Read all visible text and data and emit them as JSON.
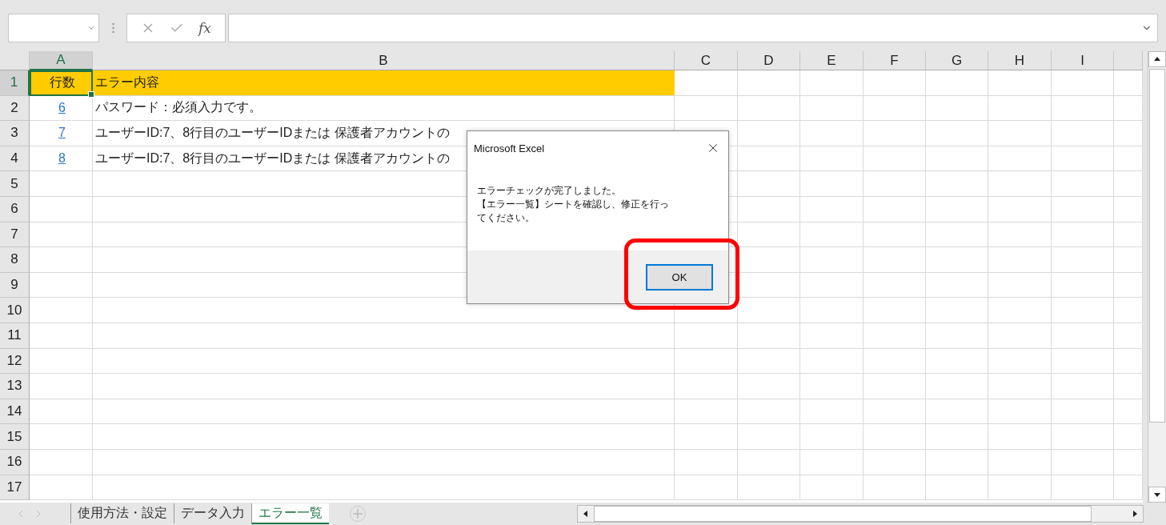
{
  "formula_bar": {
    "fx_label": "fx"
  },
  "columns": [
    {
      "label": "A",
      "selected": true
    },
    {
      "label": "B",
      "selected": false
    },
    {
      "label": "C",
      "selected": false
    },
    {
      "label": "D",
      "selected": false
    },
    {
      "label": "E",
      "selected": false
    },
    {
      "label": "F",
      "selected": false
    },
    {
      "label": "G",
      "selected": false
    },
    {
      "label": "H",
      "selected": false
    },
    {
      "label": "I",
      "selected": false
    },
    {
      "selected": false
    }
  ],
  "rows": [
    {
      "number": "1",
      "selected": true,
      "highlighted": true,
      "cells": [
        {
          "text": "行数",
          "kind": "text",
          "selected": true
        },
        {
          "text": "エラー内容",
          "kind": "text",
          "selected": false
        }
      ]
    },
    {
      "number": "2",
      "selected": false,
      "highlighted": false,
      "cells": [
        {
          "text": "6",
          "kind": "link",
          "selected": false
        },
        {
          "text": "パスワード：必須入力です。",
          "kind": "text",
          "selected": false
        }
      ]
    },
    {
      "number": "3",
      "selected": false,
      "highlighted": false,
      "cells": [
        {
          "text": "7",
          "kind": "link",
          "selected": false
        },
        {
          "text": "ユーザーID:7、8行目のユーザーIDまたは 保護者アカウントの",
          "kind": "text",
          "selected": false
        }
      ]
    },
    {
      "number": "4",
      "selected": false,
      "highlighted": false,
      "cells": [
        {
          "text": "8",
          "kind": "link",
          "selected": false
        },
        {
          "text": "ユーザーID:7、8行目のユーザーIDまたは 保護者アカウントの",
          "kind": "text",
          "selected": false
        }
      ]
    },
    {
      "number": "5",
      "selected": false,
      "highlighted": false,
      "cells": []
    },
    {
      "number": "6",
      "selected": false,
      "highlighted": false,
      "cells": []
    },
    {
      "number": "7",
      "selected": false,
      "highlighted": false,
      "cells": []
    },
    {
      "number": "8",
      "selected": false,
      "highlighted": false,
      "cells": []
    },
    {
      "number": "9",
      "selected": false,
      "highlighted": false,
      "cells": []
    },
    {
      "number": "10",
      "selected": false,
      "highlighted": false,
      "cells": []
    },
    {
      "number": "11",
      "selected": false,
      "highlighted": false,
      "cells": []
    },
    {
      "number": "12",
      "selected": false,
      "highlighted": false,
      "cells": []
    },
    {
      "number": "13",
      "selected": false,
      "highlighted": false,
      "cells": []
    },
    {
      "number": "14",
      "selected": false,
      "highlighted": false,
      "cells": []
    },
    {
      "number": "15",
      "selected": false,
      "highlighted": false,
      "cells": []
    },
    {
      "number": "16",
      "selected": false,
      "highlighted": false,
      "cells": []
    },
    {
      "number": "17",
      "selected": false,
      "highlighted": false,
      "cells": []
    }
  ],
  "sheet_tabs": [
    {
      "label": "使用方法・設定",
      "selected": false
    },
    {
      "label": "データ入力",
      "selected": false
    },
    {
      "label": "エラー一覧",
      "selected": true
    }
  ],
  "dialog": {
    "title": "Microsoft Excel",
    "message": [
      "エラーチェックが完了しました。",
      "【エラー一覧】シートを確認し、修正を行ってください。"
    ],
    "button": "OK",
    "button_highlighted": true
  }
}
